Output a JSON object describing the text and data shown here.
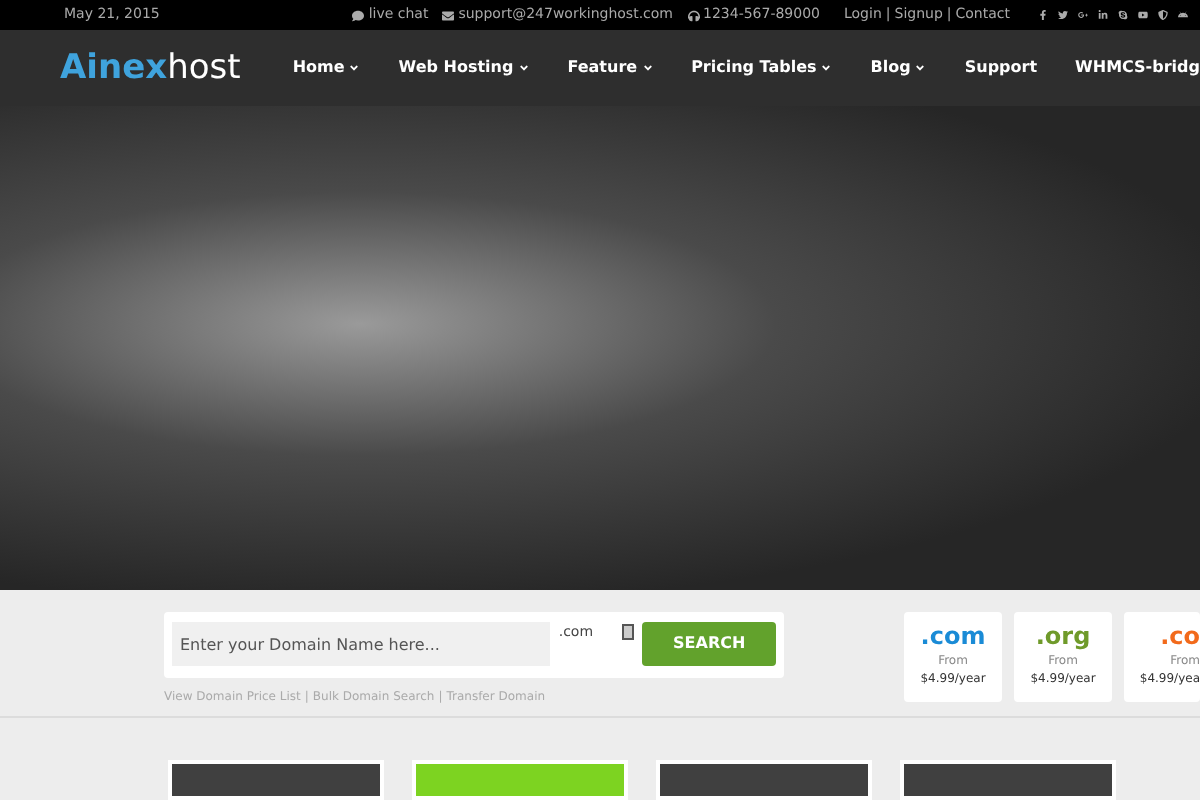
{
  "top_bar": {
    "date": "May 21, 2015",
    "live_chat": "live chat",
    "email": "support@247workinghost.com",
    "phone": "1234-567-89000",
    "account_links": [
      "Login",
      "Signup",
      "Contact"
    ],
    "separator": "|"
  },
  "logo": {
    "part_1": "Ainex",
    "part_2": "host"
  },
  "nav": [
    {
      "label": "Home",
      "dropdown": true
    },
    {
      "label": "Web Hosting",
      "dropdown": true
    },
    {
      "label": "Feature",
      "dropdown": true
    },
    {
      "label": "Pricing Tables",
      "dropdown": true
    },
    {
      "label": "Blog",
      "dropdown": true
    },
    {
      "label": "Support",
      "dropdown": false
    },
    {
      "label": "WHMCS-bridg",
      "dropdown": false
    }
  ],
  "domain_search": {
    "placeholder": "Enter your Domain Name here...",
    "tld": ".com",
    "button": "SEARCH",
    "links": [
      "View Domain Price List",
      "Bulk Domain Search",
      "Transfer Domain"
    ],
    "separator": "|"
  },
  "domain_prices": [
    {
      "tld": ".com",
      "from": "From",
      "price": "$4.99/year",
      "color": "#1a8bd6"
    },
    {
      "tld": ".org",
      "from": "From",
      "price": "$4.99/year",
      "color": "#6f9a2a"
    },
    {
      "tld": ".co",
      "from": "From",
      "price": "$4.99/yea",
      "color": "#f26a1b"
    }
  ],
  "plan_cards": [
    {
      "color": "#404040"
    },
    {
      "color": "#7dd321"
    },
    {
      "color": "#404040"
    },
    {
      "color": "#404040"
    }
  ]
}
